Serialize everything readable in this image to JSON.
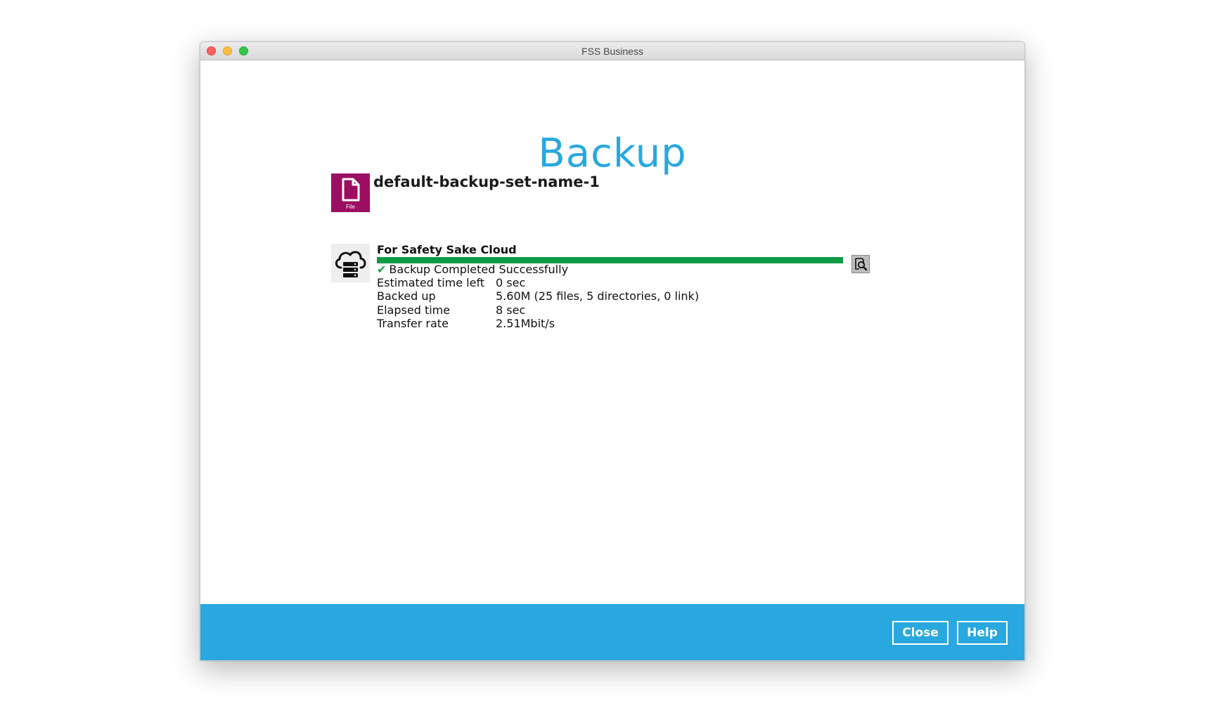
{
  "window": {
    "title": "FSS Business"
  },
  "page": {
    "title": "Backup"
  },
  "backup_set": {
    "name": "default-backup-set-name-1",
    "icon_label": "File",
    "icon_color": "#9b0e61"
  },
  "destination": {
    "name": "For Safety Sake Cloud",
    "progress_percent": 100,
    "status": "Backup Completed Successfully",
    "stats": {
      "estimated_time_left": {
        "label": "Estimated time left",
        "value": "0 sec"
      },
      "backed_up": {
        "label": "Backed up",
        "value": "5.60M (25 files, 5 directories, 0 link)"
      },
      "elapsed_time": {
        "label": "Elapsed time",
        "value": "8 sec"
      },
      "transfer_rate": {
        "label": "Transfer rate",
        "value": "2.51Mbit/s"
      }
    }
  },
  "footer": {
    "close_label": "Close",
    "help_label": "Help"
  },
  "colors": {
    "accent": "#29a8e0",
    "progress": "#0d9a45",
    "success": "#1aa23b"
  },
  "icons": [
    "file-icon",
    "cloud-server-icon",
    "check-icon",
    "magnifier-icon"
  ]
}
